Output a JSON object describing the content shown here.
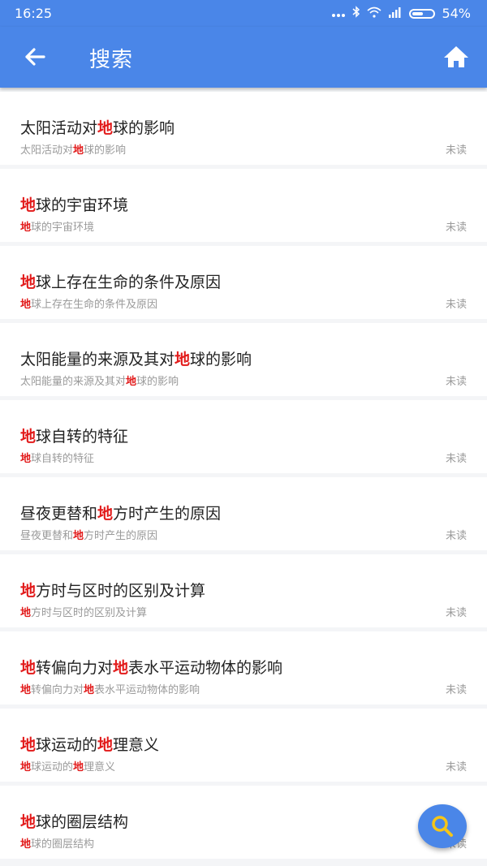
{
  "status_bar": {
    "time": "16:25",
    "battery_text": "54%",
    "battery_level": 0.54
  },
  "app_bar": {
    "title": "搜索"
  },
  "keyword": "地",
  "results": [
    {
      "parts": [
        [
          "太阳活动对",
          0
        ],
        [
          "地",
          1
        ],
        [
          "球的影响",
          0
        ]
      ],
      "status": "未读"
    },
    {
      "parts": [
        [
          "地",
          1
        ],
        [
          "球的宇宙环境",
          0
        ]
      ],
      "status": "未读"
    },
    {
      "parts": [
        [
          "地",
          1
        ],
        [
          "球上存在生命的条件及原因",
          0
        ]
      ],
      "status": "未读"
    },
    {
      "parts": [
        [
          "太阳能量的来源及其对",
          0
        ],
        [
          "地",
          1
        ],
        [
          "球的影响",
          0
        ]
      ],
      "status": "未读"
    },
    {
      "parts": [
        [
          "地",
          1
        ],
        [
          "球自转的特征",
          0
        ]
      ],
      "status": "未读"
    },
    {
      "parts": [
        [
          "昼夜更替和",
          0
        ],
        [
          "地",
          1
        ],
        [
          "方时产生的原因",
          0
        ]
      ],
      "status": "未读"
    },
    {
      "parts": [
        [
          "地",
          1
        ],
        [
          "方时与区时的区别及计算",
          0
        ]
      ],
      "status": "未读"
    },
    {
      "parts": [
        [
          "地",
          1
        ],
        [
          "转偏向力对",
          0
        ],
        [
          "地",
          1
        ],
        [
          "表水平运动物体的影响",
          0
        ]
      ],
      "status": "未读"
    },
    {
      "parts": [
        [
          "地",
          1
        ],
        [
          "球运动的",
          0
        ],
        [
          "地",
          1
        ],
        [
          "理意义",
          0
        ]
      ],
      "status": "未读"
    },
    {
      "parts": [
        [
          "地",
          1
        ],
        [
          "球的圈层结构",
          0
        ]
      ],
      "status": "未读"
    }
  ],
  "colors": {
    "primary": "#4a86e8",
    "highlight": "#e21b1b"
  },
  "icons": {
    "back": "arrow-left-icon",
    "home": "home-icon",
    "fab": "search-icon"
  }
}
